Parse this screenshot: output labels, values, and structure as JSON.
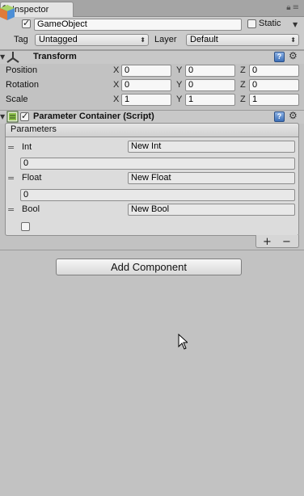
{
  "tab": {
    "label": "Inspector",
    "icon": "info-icon"
  },
  "gameobject": {
    "active": true,
    "name": "GameObject",
    "static_label": "Static",
    "static_checked": false,
    "tag_label": "Tag",
    "tag_value": "Untagged",
    "layer_label": "Layer",
    "layer_value": "Default"
  },
  "transform": {
    "title": "Transform",
    "rows": [
      {
        "label": "Position",
        "x": "0",
        "y": "0",
        "z": "0"
      },
      {
        "label": "Rotation",
        "x": "0",
        "y": "0",
        "z": "0"
      },
      {
        "label": "Scale",
        "x": "1",
        "y": "1",
        "z": "1"
      }
    ],
    "axis": {
      "x": "X",
      "y": "Y",
      "z": "Z"
    }
  },
  "script": {
    "title": "Parameter Container (Script)",
    "list_header": "Parameters",
    "items": [
      {
        "label": "Int",
        "name": "New Int",
        "value": "0"
      },
      {
        "label": "Float",
        "name": "New Float",
        "value": "0"
      },
      {
        "label": "Bool",
        "name": "New Bool",
        "value_checked": false
      }
    ],
    "add_symbol": "+",
    "remove_symbol": "−"
  },
  "add_component_label": "Add Component",
  "colors": {
    "help_icon": "#3c6fb8",
    "background": "#c2c2c2"
  }
}
